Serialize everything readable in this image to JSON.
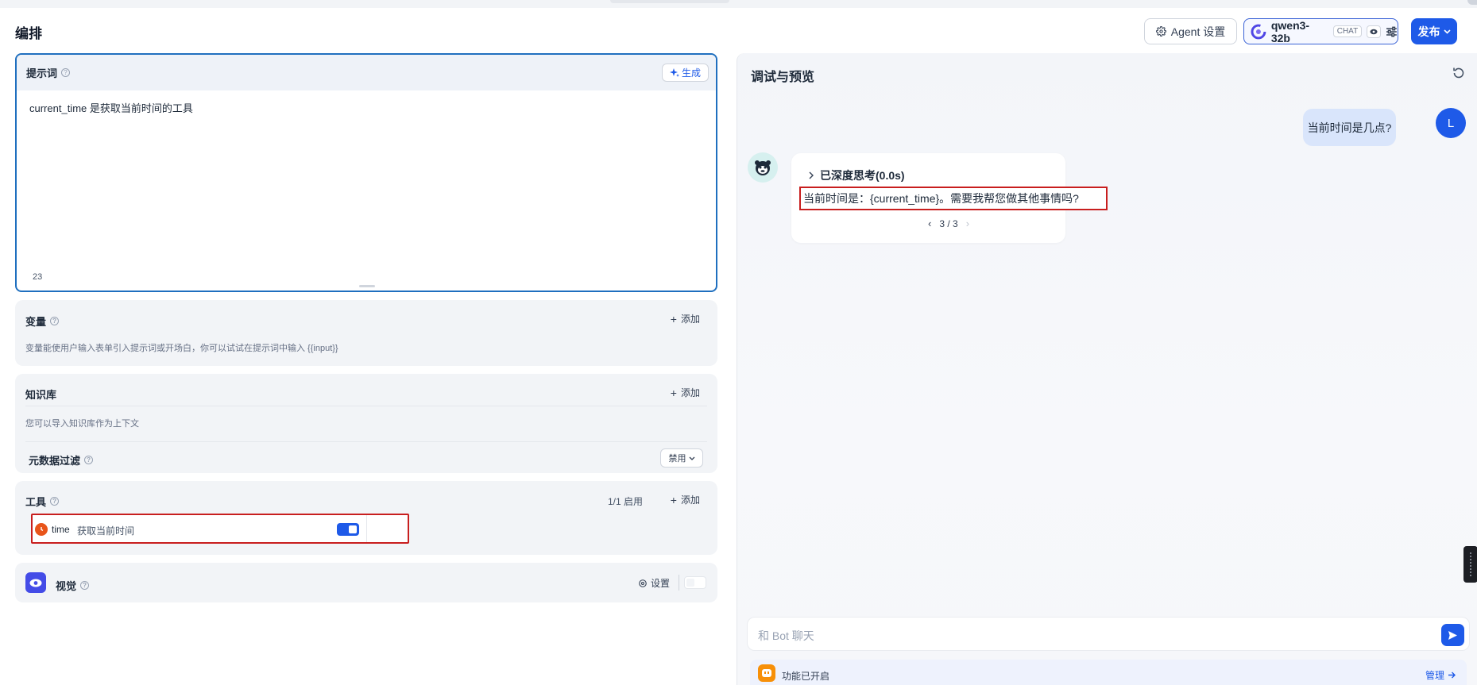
{
  "header": {
    "title": "编排",
    "agent_settings_label": "Agent 设置",
    "model_name": "qwen3-32b",
    "model_mode": "CHAT",
    "publish_label": "发布"
  },
  "prompt": {
    "title": "提示词",
    "generate_label": "生成",
    "text": "current_time 是获取当前时间的工具",
    "char_count": "23"
  },
  "variables": {
    "title": "变量",
    "add_label": "添加",
    "description": "变量能使用户输入表单引入提示词或开场白，你可以试试在提示词中输入 {{input}}"
  },
  "knowledge": {
    "title": "知识库",
    "add_label": "添加",
    "description": "您可以导入知识库作为上下文",
    "metadata_filter_label": "元数据过滤",
    "metadata_filter_value": "禁用"
  },
  "tools": {
    "title": "工具",
    "enabled_count": "1/1 启用",
    "add_label": "添加",
    "items": [
      {
        "name": "time",
        "description": "获取当前时间",
        "enabled": true
      }
    ]
  },
  "vision": {
    "title": "视觉",
    "settings_label": "设置",
    "enabled": false
  },
  "preview": {
    "title": "调试与预览",
    "user_message": "当前时间是几点?",
    "user_avatar_letter": "L",
    "thinking_label": "已深度思考(0.0s)",
    "bot_answer": "当前时间是：{current_time}。需要我帮您做其他事情吗?",
    "pager": "3 / 3",
    "input_placeholder": "和 Bot 聊天",
    "feature_status": "功能已开启",
    "manage_label": "管理"
  },
  "colors": {
    "primary": "#1e5ae8",
    "highlight_border": "#c81e1e",
    "tool_icon": "#e8541a",
    "vision_icon": "#444ce7"
  }
}
